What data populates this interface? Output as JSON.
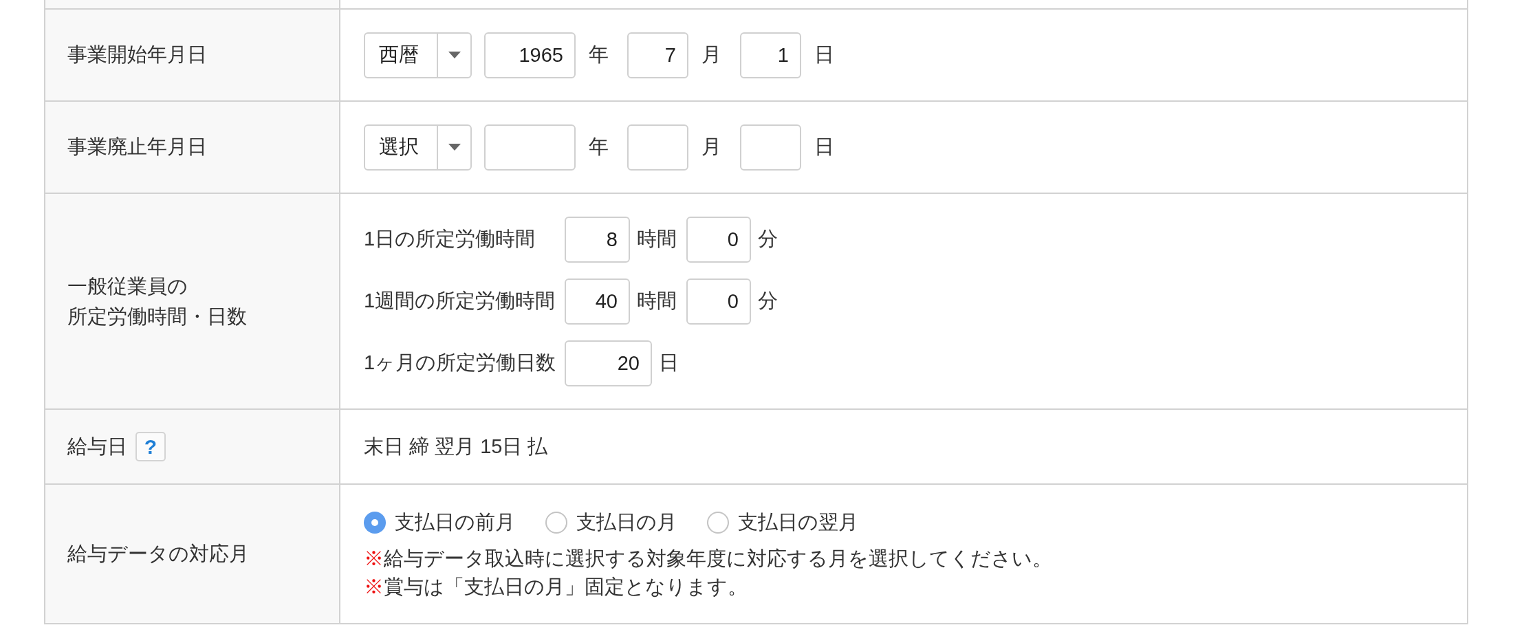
{
  "form": {
    "rows": [
      {
        "kind": "date",
        "label": "事業開始年月日",
        "select": {
          "value": "西暦"
        },
        "parts": [
          {
            "kind": "year",
            "value": "1965",
            "unit": "年"
          },
          {
            "kind": "month",
            "value": "7",
            "unit": "月"
          },
          {
            "kind": "day",
            "value": "1",
            "unit": "日"
          }
        ]
      },
      {
        "kind": "date",
        "label": "事業廃止年月日",
        "select": {
          "value": "選択"
        },
        "parts": [
          {
            "kind": "year",
            "unit": "年"
          },
          {
            "kind": "month",
            "unit": "月"
          },
          {
            "kind": "day",
            "unit": "日"
          }
        ]
      },
      {
        "kind": "work_hours",
        "label_lines": [
          "一般従業員の",
          "所定労働時間・日数"
        ],
        "lines": [
          {
            "label": "1日の所定労働時間",
            "parts": [
              {
                "kind": "hours",
                "value": "8",
                "unit": "時間"
              },
              {
                "kind": "minutes",
                "value": "0",
                "unit": "分"
              }
            ]
          },
          {
            "label": "1週間の所定労働時間",
            "parts": [
              {
                "kind": "hours",
                "value": "40",
                "unit": "時間"
              },
              {
                "kind": "minutes",
                "value": "0",
                "unit": "分"
              }
            ]
          },
          {
            "label": "1ヶ月の所定労働日数",
            "parts": [
              {
                "kind": "days",
                "value": "20",
                "unit": "日"
              }
            ]
          }
        ]
      },
      {
        "kind": "text",
        "label": "給与日",
        "help_button": "?",
        "value": "末日 締 翌月 15日 払"
      },
      {
        "kind": "radio",
        "label": "給与データの対応月",
        "options": [
          {
            "label": "支払日の前月",
            "selected": true
          },
          {
            "label": "支払日の月",
            "selected": false
          },
          {
            "label": "支払日の翌月",
            "selected": false
          }
        ],
        "notes": [
          {
            "mark": "※",
            "text": "給与データ取込時に選択する対象年度に対応する月を選択してください。"
          },
          {
            "mark": "※",
            "text": "賞与は「支払日の月」固定となります。"
          }
        ]
      }
    ]
  }
}
